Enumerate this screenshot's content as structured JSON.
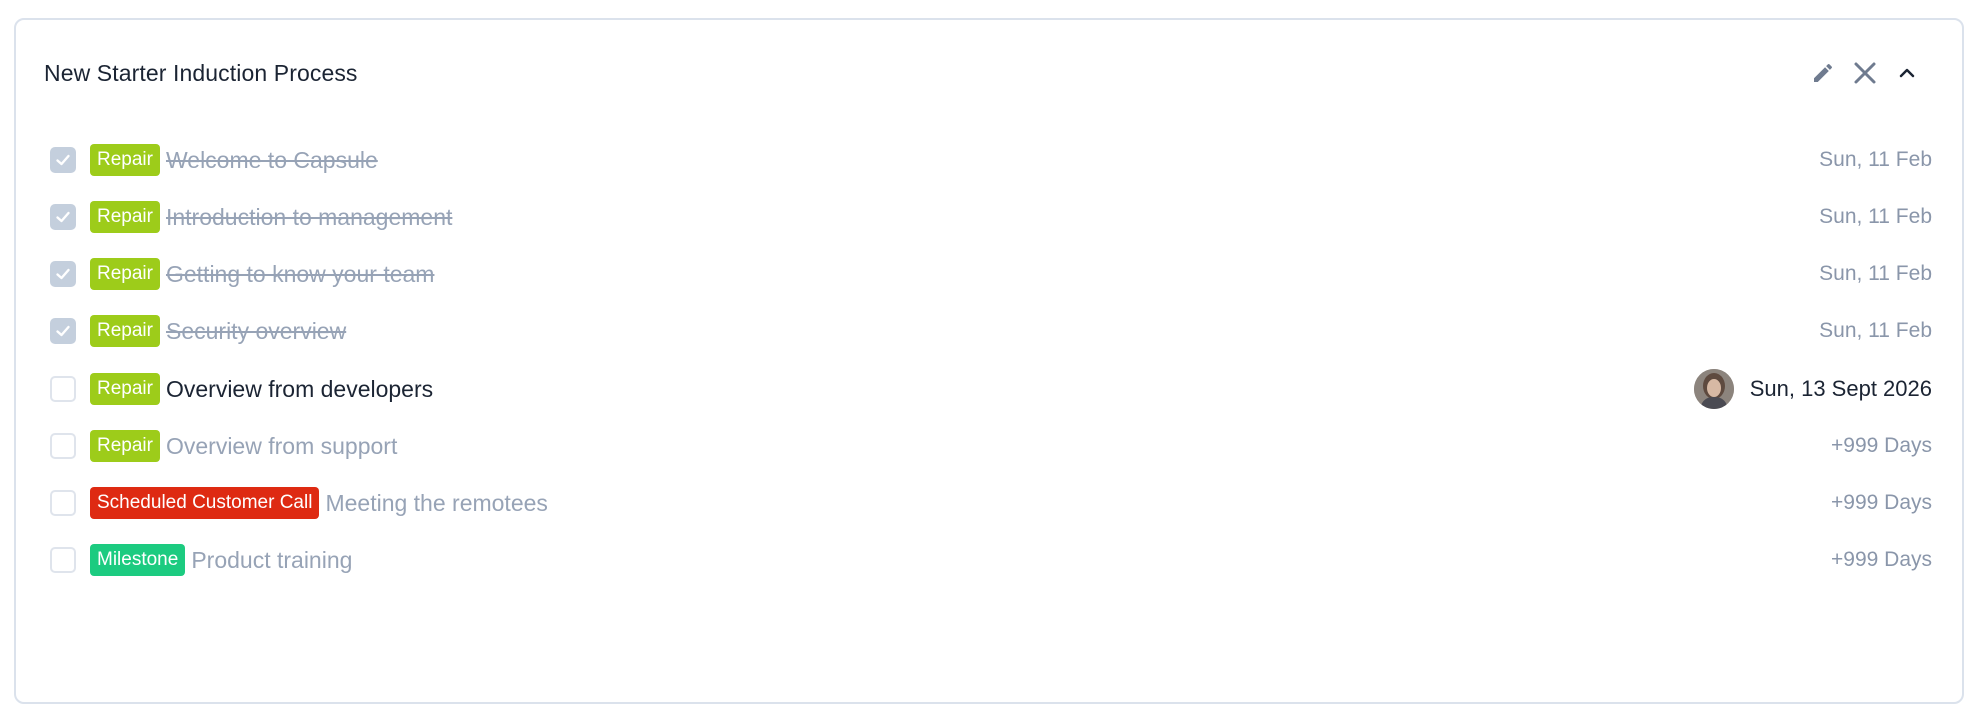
{
  "panel": {
    "title": "New Starter Induction Process"
  },
  "header_actions": {
    "edit_icon": "pencil-icon",
    "close_icon": "close-icon",
    "collapse_icon": "chevron-up-icon"
  },
  "colors": {
    "repair": "#9dcc1a",
    "scheduled_customer_call": "#de2a12",
    "milestone": "#1ccb80",
    "done_text": "#97a3b6",
    "active_text": "#1b2433"
  },
  "tasks": [
    {
      "tag": "Repair",
      "label": "Welcome to Capsule",
      "date": "Sun, 11 Feb",
      "done": true
    },
    {
      "tag": "Repair",
      "label": "Introduction to management",
      "date": "Sun, 11 Feb",
      "done": true
    },
    {
      "tag": "Repair",
      "label": "Getting to know your team",
      "date": "Sun, 11 Feb",
      "done": true
    },
    {
      "tag": "Repair",
      "label": "Security overview",
      "date": "Sun, 11 Feb",
      "done": true
    },
    {
      "tag": "Repair",
      "label": "Overview from developers",
      "date": "Sun, 13 Sept 2026",
      "done": false,
      "assignee_avatar": "avatar"
    },
    {
      "tag": "Repair",
      "label": "Overview from support",
      "date": "+999 Days",
      "done": false
    },
    {
      "tag": "Scheduled Customer Call",
      "label": "Meeting the remotees",
      "date": "+999 Days",
      "done": false
    },
    {
      "tag": "Milestone",
      "label": "Product training",
      "date": "+999 Days",
      "done": false
    }
  ]
}
